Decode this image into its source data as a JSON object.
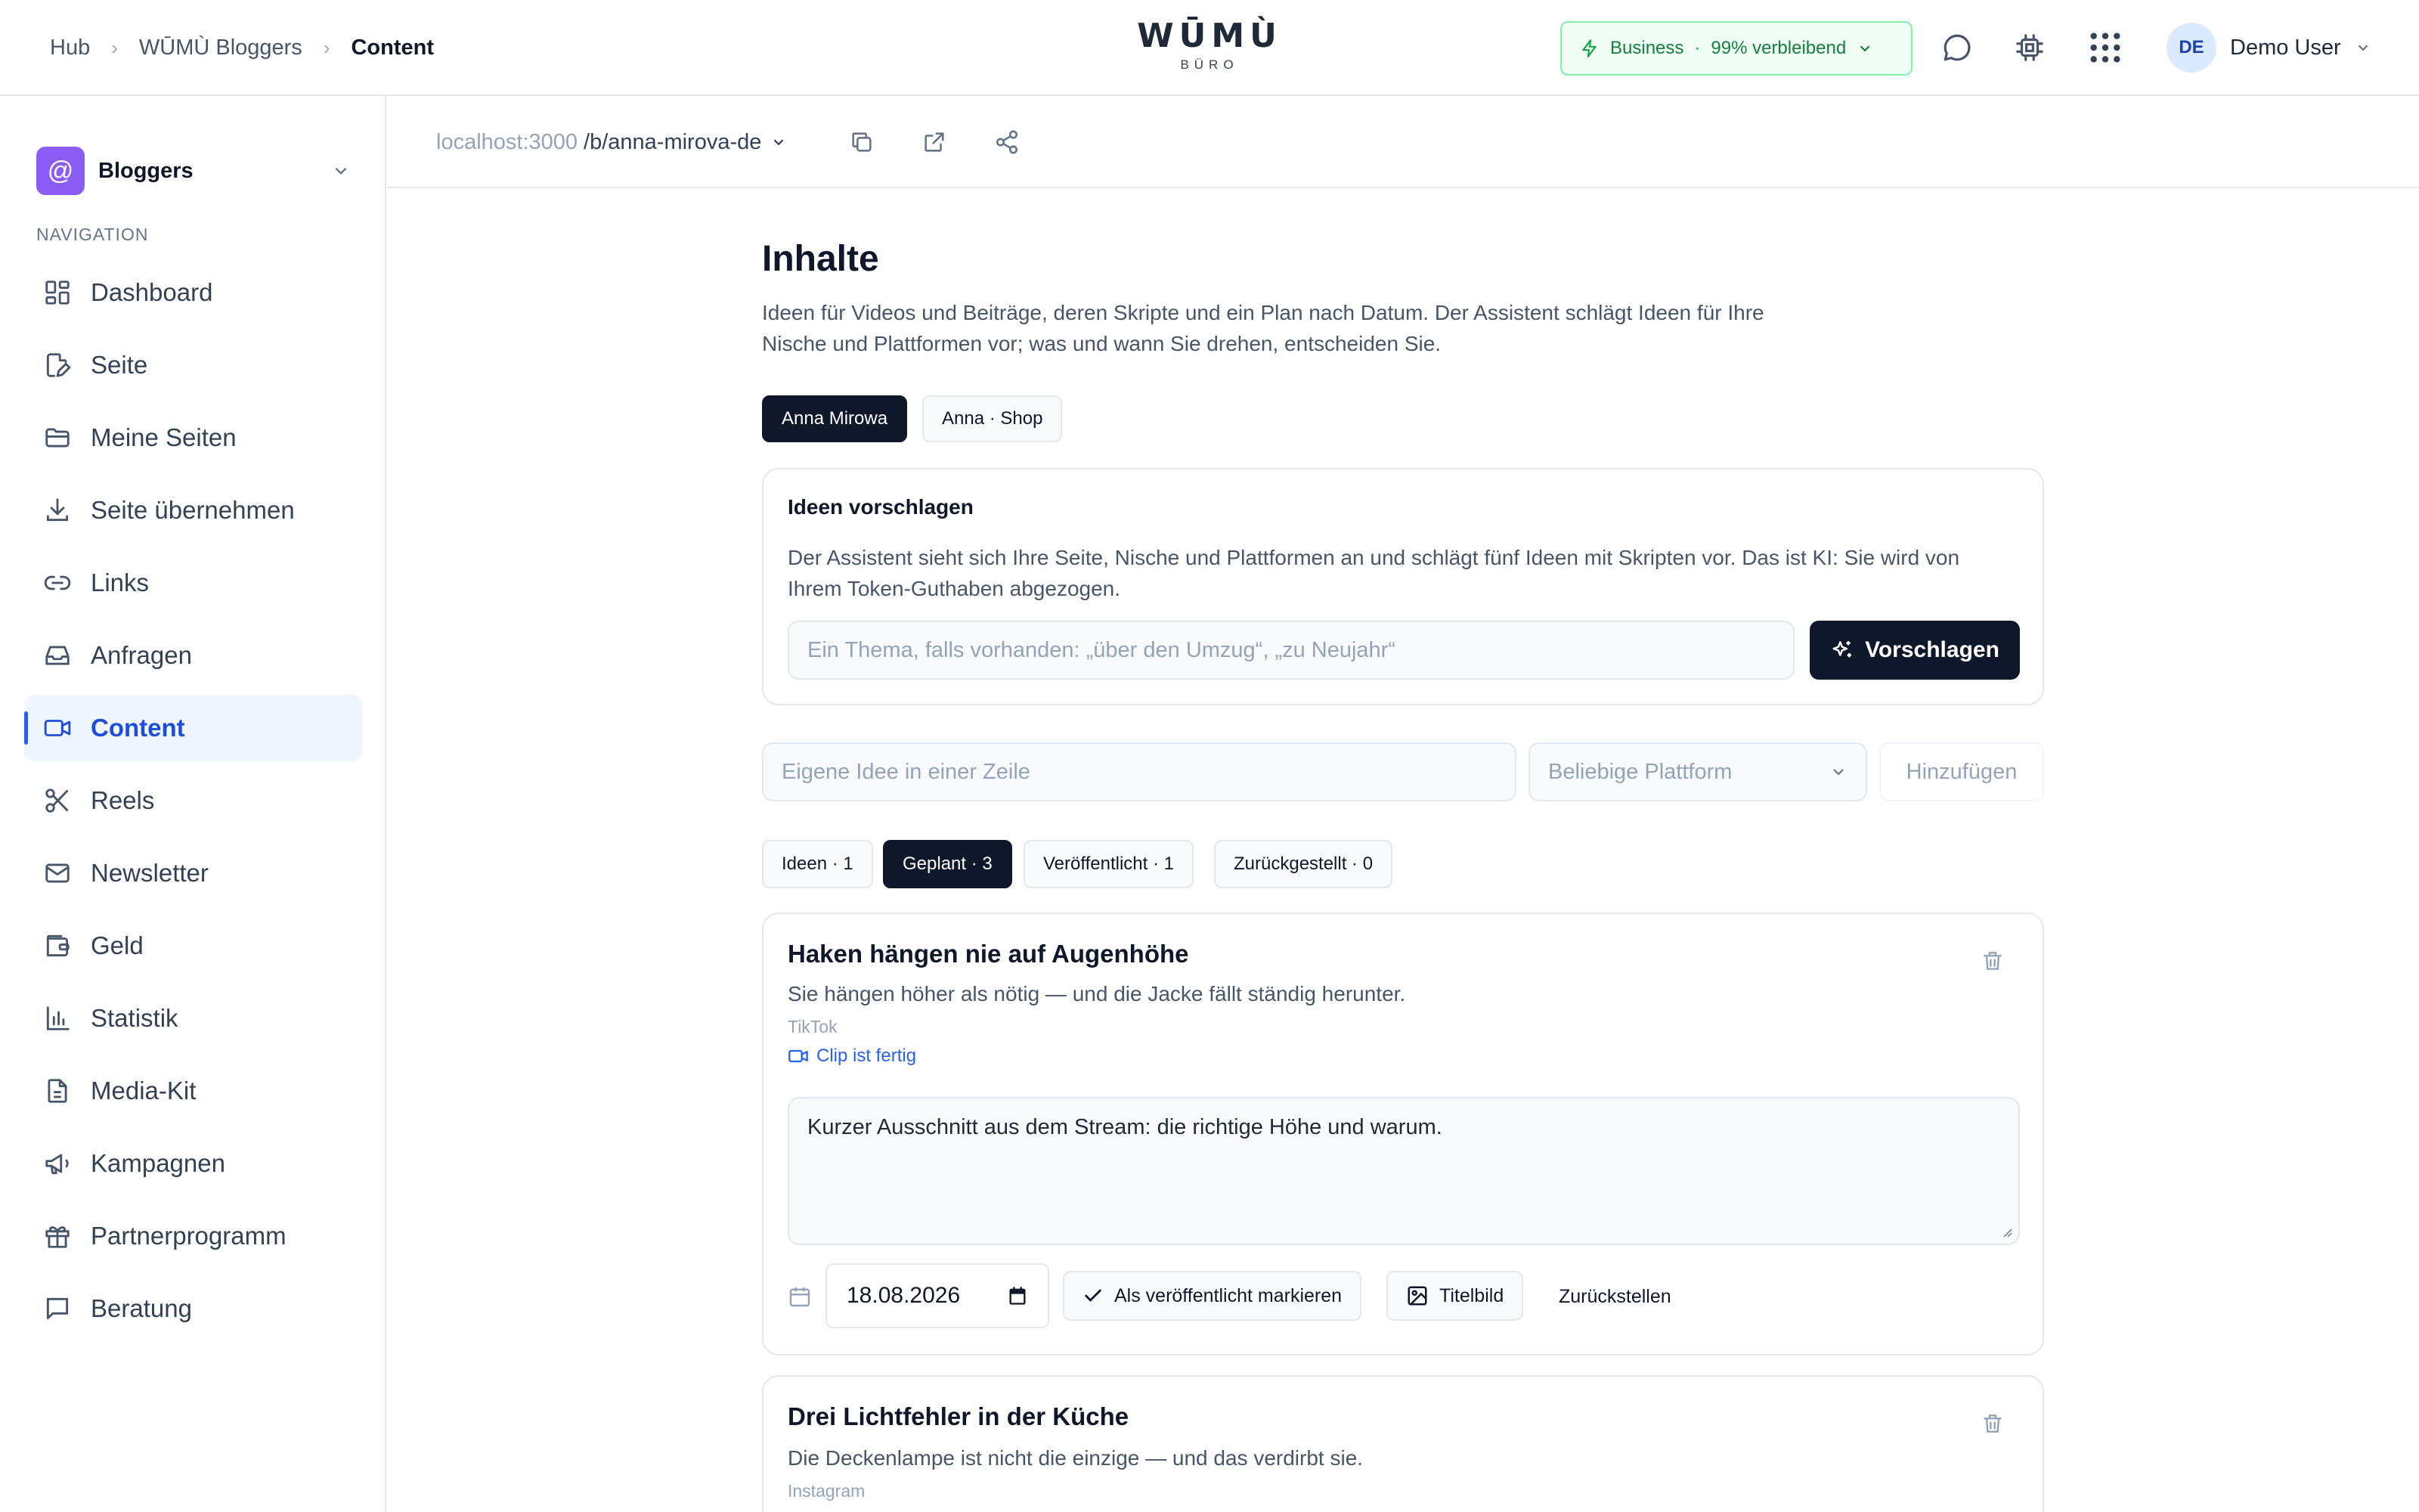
{
  "breadcrumbs": [
    "Hub",
    "WŪMÙ Bloggers",
    "Content"
  ],
  "logo": {
    "main": "WŪMÙ",
    "sub": "BÜRO"
  },
  "plan": {
    "name": "Business",
    "separator": "·",
    "remaining": "99% verbleibend"
  },
  "user": {
    "initials": "DE",
    "name": "Demo User"
  },
  "workspace": {
    "badge": "@",
    "name": "Bloggers"
  },
  "nav": {
    "title": "NAVIGATION",
    "items": [
      {
        "label": "Dashboard",
        "icon": "dashboard-icon"
      },
      {
        "label": "Seite",
        "icon": "page-edit-icon"
      },
      {
        "label": "Meine Seiten",
        "icon": "folder-icon"
      },
      {
        "label": "Seite übernehmen",
        "icon": "download-icon"
      },
      {
        "label": "Links",
        "icon": "link-icon"
      },
      {
        "label": "Anfragen",
        "icon": "inbox-icon"
      },
      {
        "label": "Content",
        "icon": "video-icon"
      },
      {
        "label": "Reels",
        "icon": "scissors-icon"
      },
      {
        "label": "Newsletter",
        "icon": "mail-icon"
      },
      {
        "label": "Geld",
        "icon": "wallet-icon"
      },
      {
        "label": "Statistik",
        "icon": "bar-chart-icon"
      },
      {
        "label": "Media-Kit",
        "icon": "document-icon"
      },
      {
        "label": "Kampagnen",
        "icon": "megaphone-icon"
      },
      {
        "label": "Partnerprogramm",
        "icon": "gift-icon"
      },
      {
        "label": "Beratung",
        "icon": "chat-icon"
      }
    ],
    "active_index": 6
  },
  "url": {
    "host": "localhost:3000",
    "path": "/b/anna-mirova-de"
  },
  "page": {
    "title": "Inhalte",
    "description": "Ideen für Videos und Beiträge, deren Skripte und ein Plan nach Datum. Der Assistent schlägt Ideen für Ihre Nische und Plattformen vor; was und wann Sie drehen, entscheiden Sie."
  },
  "profiles": [
    "Anna Mirowa",
    "Anna · Shop"
  ],
  "suggest": {
    "title": "Ideen vorschlagen",
    "text": "Der Assistent sieht sich Ihre Seite, Nische und Plattformen an und schlägt fünf Ideen mit Skripten vor. Das ist KI: Sie wird von Ihrem Token-Guthaben abgezogen.",
    "placeholder": "Ein Thema, falls vorhanden: „über den Umzug“, „zu Neujahr“",
    "button": "Vorschlagen"
  },
  "add": {
    "placeholder": "Eigene Idee in einer Zeile",
    "platform_select": "Beliebige Plattform",
    "button": "Hinzufügen"
  },
  "filters": [
    "Ideen · 1",
    "Geplant · 3",
    "Veröffentlicht · 1",
    "Zurückgestellt · 0"
  ],
  "items": [
    {
      "title": "Haken hängen nie auf Augenhöhe",
      "subtitle": "Sie hängen höher als nötig — und die Jacke fällt ständig herunter.",
      "platform": "TikTok",
      "clip": "Clip ist fertig",
      "script": "Kurzer Ausschnitt aus dem Stream: die richtige Höhe und warum.",
      "date": "18.08.2026",
      "mark_published": "Als veröffentlicht markieren",
      "cover": "Titelbild",
      "postpone": "Zurückstellen"
    },
    {
      "title": "Drei Lichtfehler in der Küche",
      "subtitle": "Die Deckenlampe ist nicht die einzige — und das verdirbt sie.",
      "platform": "Instagram"
    }
  ],
  "colors": {
    "accent": "#2563eb",
    "dark": "#0f172a",
    "plan_green": "#15803d",
    "workspace": "#8b5cf6"
  }
}
